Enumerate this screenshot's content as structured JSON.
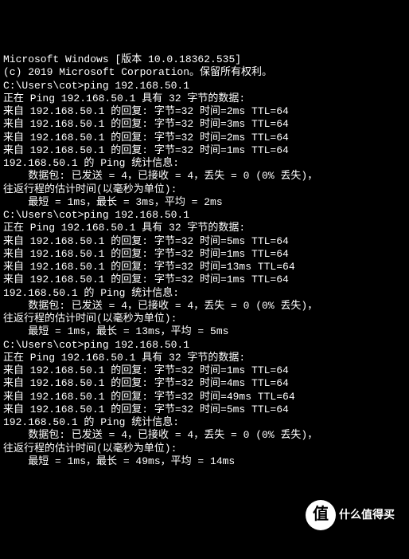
{
  "header": {
    "line1": "Microsoft Windows [版本 10.0.18362.535]",
    "line2": "(c) 2019 Microsoft Corporation。保留所有权利。"
  },
  "prompt": "C:\\Users\\cot>",
  "command": "ping 192.168.50.1",
  "blank": "",
  "sessions": [
    {
      "header": "正在 Ping 192.168.50.1 具有 32 字节的数据:",
      "replies": [
        "来自 192.168.50.1 的回复: 字节=32 时间=2ms TTL=64",
        "来自 192.168.50.1 的回复: 字节=32 时间=3ms TTL=64",
        "来自 192.168.50.1 的回复: 字节=32 时间=2ms TTL=64",
        "来自 192.168.50.1 的回复: 字节=32 时间=1ms TTL=64"
      ],
      "stats_title": "192.168.50.1 的 Ping 统计信息:",
      "stats_packets": "    数据包: 已发送 = 4，已接收 = 4，丢失 = 0 (0% 丢失)，",
      "stats_rtt_title": "往返行程的估计时间(以毫秒为单位):",
      "stats_rtt": "    最短 = 1ms，最长 = 3ms，平均 = 2ms"
    },
    {
      "header": "正在 Ping 192.168.50.1 具有 32 字节的数据:",
      "replies": [
        "来自 192.168.50.1 的回复: 字节=32 时间=5ms TTL=64",
        "来自 192.168.50.1 的回复: 字节=32 时间=1ms TTL=64",
        "来自 192.168.50.1 的回复: 字节=32 时间=13ms TTL=64",
        "来自 192.168.50.1 的回复: 字节=32 时间=1ms TTL=64"
      ],
      "stats_title": "192.168.50.1 的 Ping 统计信息:",
      "stats_packets": "    数据包: 已发送 = 4，已接收 = 4，丢失 = 0 (0% 丢失)，",
      "stats_rtt_title": "往返行程的估计时间(以毫秒为单位):",
      "stats_rtt": "    最短 = 1ms，最长 = 13ms，平均 = 5ms"
    },
    {
      "header": "正在 Ping 192.168.50.1 具有 32 字节的数据:",
      "replies": [
        "来自 192.168.50.1 的回复: 字节=32 时间=1ms TTL=64",
        "来自 192.168.50.1 的回复: 字节=32 时间=4ms TTL=64",
        "来自 192.168.50.1 的回复: 字节=32 时间=49ms TTL=64",
        "来自 192.168.50.1 的回复: 字节=32 时间=5ms TTL=64"
      ],
      "stats_title": "192.168.50.1 的 Ping 统计信息:",
      "stats_packets": "    数据包: 已发送 = 4，已接收 = 4，丢失 = 0 (0% 丢失)，",
      "stats_rtt_title": "往返行程的估计时间(以毫秒为单位):",
      "stats_rtt": "    最短 = 1ms，最长 = 49ms，平均 = 14ms"
    }
  ],
  "watermark": {
    "badge": "值",
    "text": "什么值得买"
  }
}
